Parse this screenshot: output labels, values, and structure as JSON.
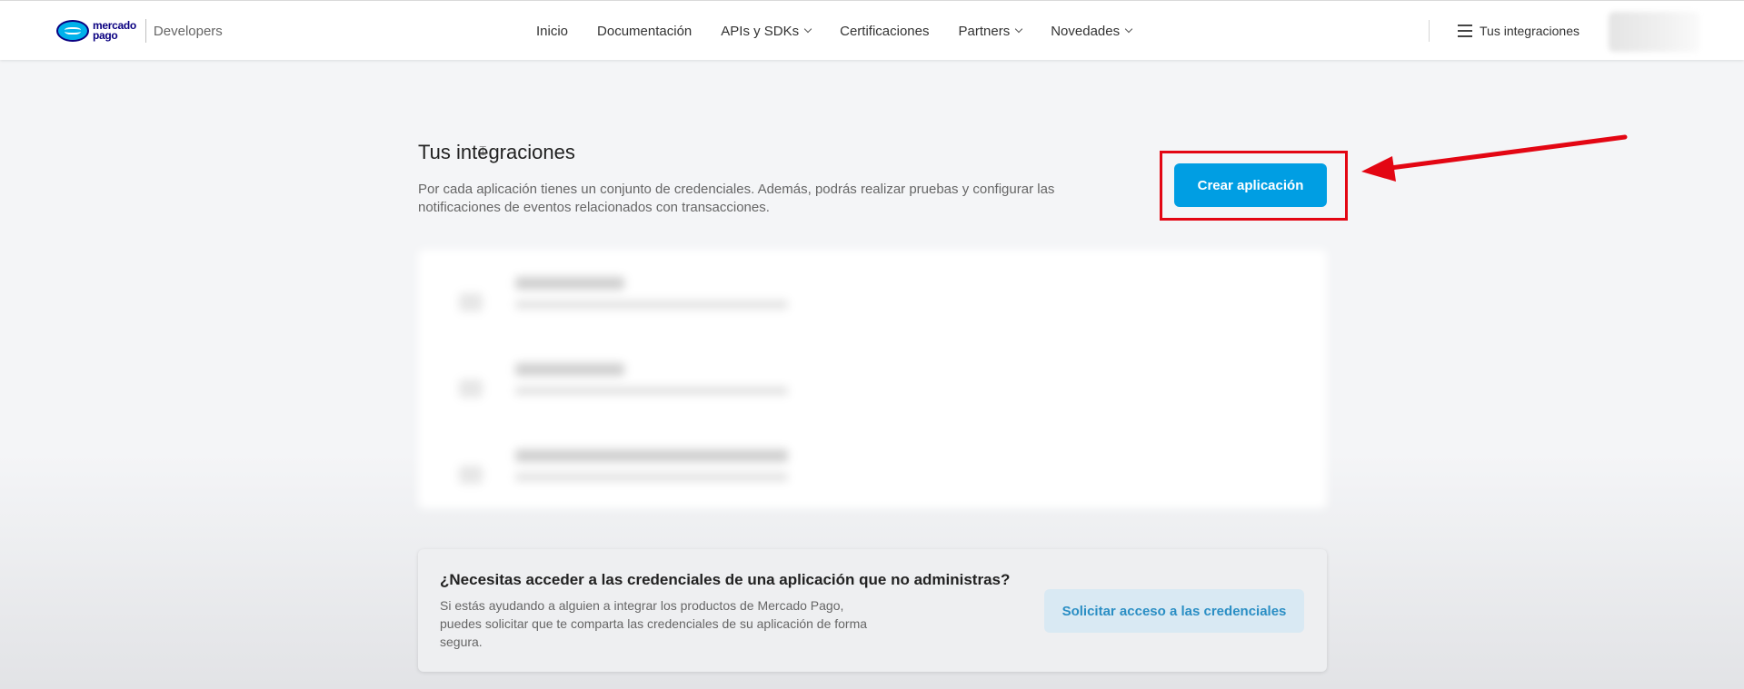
{
  "header": {
    "logo_line1": "mercado",
    "logo_line2": "pago",
    "logo_product": "Developers",
    "nav": [
      {
        "label": "Inicio",
        "dropdown": false
      },
      {
        "label": "Documentación",
        "dropdown": false
      },
      {
        "label": "APIs y SDKs",
        "dropdown": true
      },
      {
        "label": "Certificaciones",
        "dropdown": false
      },
      {
        "label": "Partners",
        "dropdown": true
      },
      {
        "label": "Novedades",
        "dropdown": true
      }
    ],
    "integrations_link": "Tus integraciones"
  },
  "main": {
    "title": "Tus integraciones",
    "description": "Por cada aplicación tienes un conjunto de credenciales. Además, podrás realizar pruebas y configurar las notificaciones de eventos relacionados con transacciones.",
    "create_button": "Crear aplicación"
  },
  "credentials": {
    "title": "¿Necesitas acceder a las credenciales de una aplicación que no administras?",
    "description": "Si estás ayudando a alguien a integrar los productos de Mercado Pago, puedes solicitar que te comparta las credenciales de su aplicación de forma segura.",
    "button": "Solicitar acceso a las credenciales"
  },
  "colors": {
    "primary": "#009ee3",
    "annotation": "#e30613",
    "secondary_button_bg": "#d9e9f3"
  }
}
